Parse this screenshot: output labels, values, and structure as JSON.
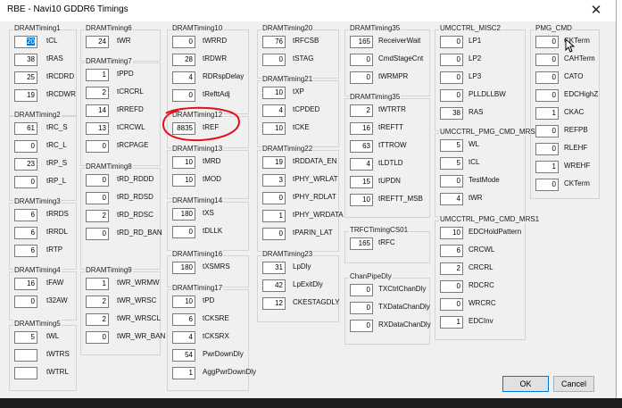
{
  "window": {
    "title": "RBE - Navi10 GDDR6 Timings",
    "close": "✕"
  },
  "buttons": {
    "ok": "OK",
    "cancel": "Cancel"
  },
  "groups": {
    "dt1": {
      "title": "DRAMTiming1",
      "rows": [
        [
          "20",
          "tCL"
        ],
        [
          "38",
          "tRAS"
        ],
        [
          "25",
          "tRCDRD"
        ],
        [
          "19",
          "tRCDWR"
        ]
      ]
    },
    "dt2": {
      "title": "DRAMTiming2",
      "rows": [
        [
          "61",
          "tRC_S"
        ],
        [
          "0",
          "tRC_L"
        ],
        [
          "23",
          "tRP_S"
        ],
        [
          "0",
          "tRP_L"
        ]
      ]
    },
    "dt3": {
      "title": "DRAMTiming3",
      "rows": [
        [
          "6",
          "tRRDS"
        ],
        [
          "6",
          "tRRDL"
        ],
        [
          "6",
          "tRTP"
        ]
      ]
    },
    "dt4": {
      "title": "DRAMTiming4",
      "rows": [
        [
          "16",
          "tFAW"
        ],
        [
          "0",
          "t32AW"
        ]
      ]
    },
    "dt5": {
      "title": "DRAMTiming5",
      "rows": [
        [
          "5",
          "tWL"
        ],
        [
          "",
          "tWTRS"
        ],
        [
          "",
          "tWTRL"
        ]
      ]
    },
    "dt6": {
      "title": "DRAMTiming6",
      "rows": [
        [
          "24",
          "tWR"
        ]
      ]
    },
    "dt7": {
      "title": "DRAMTiming7",
      "rows": [
        [
          "1",
          "tPPD"
        ],
        [
          "2",
          "tCRCRL"
        ],
        [
          "14",
          "tRREFD"
        ],
        [
          "13",
          "tCRCWL"
        ],
        [
          "0",
          "tRCPAGE"
        ]
      ]
    },
    "dt8": {
      "title": "DRAMTiming8",
      "rows": [
        [
          "0",
          "tRD_RDDD"
        ],
        [
          "0",
          "tRD_RDSD"
        ],
        [
          "2",
          "tRD_RDSC"
        ],
        [
          "0",
          "tRD_RD_BAN"
        ]
      ]
    },
    "dt9": {
      "title": "DRAMTiming9",
      "rows": [
        [
          "1",
          "tWR_WRMW"
        ],
        [
          "2",
          "tWR_WRSC"
        ],
        [
          "2",
          "tWR_WRSCL"
        ],
        [
          "0",
          "tWR_WR_BAN"
        ]
      ]
    },
    "dt10": {
      "title": "DRAMTiming10",
      "rows": [
        [
          "0",
          "tWRRD"
        ],
        [
          "28",
          "tRDWR"
        ],
        [
          "4",
          "RDRspDelay"
        ],
        [
          "0",
          "tRefttAdj"
        ]
      ]
    },
    "dt12": {
      "title": "DRAMTiming12",
      "rows": [
        [
          "8835",
          "tREF"
        ]
      ]
    },
    "dt13": {
      "title": "DRAMTiming13",
      "rows": [
        [
          "10",
          "tMRD"
        ],
        [
          "10",
          "tMOD"
        ]
      ]
    },
    "dt14": {
      "title": "DRAMTiming14",
      "rows": [
        [
          "180",
          "tXS"
        ],
        [
          "0",
          "tDLLK"
        ]
      ]
    },
    "dt16": {
      "title": "DRAMTiming16",
      "rows": [
        [
          "180",
          "tXSMRS"
        ]
      ]
    },
    "dt17": {
      "title": "DRAMTiming17",
      "rows": [
        [
          "10",
          "tPD"
        ],
        [
          "6",
          "tCKSRE"
        ],
        [
          "4",
          "tCKSRX"
        ],
        [
          "54",
          "PwrDownDly"
        ],
        [
          "1",
          "AggPwrDownDly"
        ]
      ]
    },
    "dt20": {
      "title": "DRAMTiming20",
      "rows": [
        [
          "76",
          "tRFCSB"
        ],
        [
          "0",
          "tSTAG"
        ]
      ]
    },
    "dt21": {
      "title": "DRAMTiming21",
      "rows": [
        [
          "10",
          "tXP"
        ],
        [
          "4",
          "tCPDED"
        ],
        [
          "10",
          "tCKE"
        ]
      ]
    },
    "dt22": {
      "title": "DRAMTiming22",
      "rows": [
        [
          "19",
          "tRDDATA_EN"
        ],
        [
          "3",
          "tPHY_WRLAT"
        ],
        [
          "0",
          "tPHY_RDLAT"
        ],
        [
          "1",
          "tPHY_WRDATA"
        ],
        [
          "0",
          "tPARIN_LAT"
        ]
      ]
    },
    "dt23": {
      "title": "DRAMTiming23",
      "rows": [
        [
          "31",
          "LpDly"
        ],
        [
          "42",
          "LpExitDly"
        ],
        [
          "12",
          "CKESTAGDLY"
        ]
      ]
    },
    "dt35a": {
      "title": "DRAMTiming35",
      "rows": [
        [
          "165",
          "ReceiverWait"
        ],
        [
          "0",
          "CmdStageCnt"
        ],
        [
          "0",
          "tWRMPR"
        ]
      ]
    },
    "dt35b": {
      "title": "DRAMTiming35",
      "rows": [
        [
          "2",
          "tWTRTR"
        ],
        [
          "16",
          "tREFTT"
        ],
        [
          "63",
          "tTTROW"
        ],
        [
          "4",
          "tLDTLD"
        ],
        [
          "15",
          "tUPDN"
        ],
        [
          "10",
          "tREFTT_MSB"
        ]
      ]
    },
    "trfc": {
      "title": "TRFCTimingCS01",
      "rows": [
        [
          "165",
          "tRFC"
        ]
      ]
    },
    "chanpipe": {
      "title": "ChanPipeDly",
      "rows": [
        [
          "0",
          "TXCtrlChanDly"
        ],
        [
          "0",
          "TXDataChanDly"
        ],
        [
          "0",
          "RXDataChanDly"
        ]
      ]
    },
    "misc2": {
      "title": "UMCCTRL_MISC2",
      "rows": [
        [
          "0",
          "LP1"
        ],
        [
          "0",
          "LP2"
        ],
        [
          "0",
          "LP3"
        ],
        [
          "0",
          "PLLDLLBW"
        ],
        [
          "38",
          "RAS"
        ]
      ]
    },
    "mrs": {
      "title": "UMCCTRL_PMG_CMD_MRS",
      "rows": [
        [
          "5",
          "WL"
        ],
        [
          "5",
          "tCL"
        ],
        [
          "0",
          "TestMode"
        ],
        [
          "4",
          "tWR"
        ]
      ]
    },
    "mrs1": {
      "title": "UMCCTRL_PMG_CMD_MRS1",
      "rows": [
        [
          "10",
          "EDCHoldPattern"
        ],
        [
          "6",
          "CRCWL"
        ],
        [
          "2",
          "CRCRL"
        ],
        [
          "0",
          "RDCRC"
        ],
        [
          "0",
          "WRCRC"
        ],
        [
          "1",
          "EDCInv"
        ]
      ]
    },
    "pmgcmd": {
      "title": "PMG_CMD",
      "rows": [
        [
          "0",
          "CKTerm"
        ],
        [
          "0",
          "CAHTerm"
        ],
        [
          "0",
          "CATO"
        ],
        [
          "0",
          "EDCHighZ"
        ],
        [
          "1",
          "CKAC"
        ],
        [
          "0",
          "REFPB"
        ],
        [
          "0",
          "RLEHF"
        ],
        [
          "1",
          "WREHF"
        ],
        [
          "0",
          "CKTerm"
        ]
      ]
    }
  },
  "icons": {
    "close": "close-icon",
    "cursor": "mouse-cursor-icon"
  },
  "colors": {
    "annotation": "#e0101c",
    "selection": "#0078d7"
  }
}
